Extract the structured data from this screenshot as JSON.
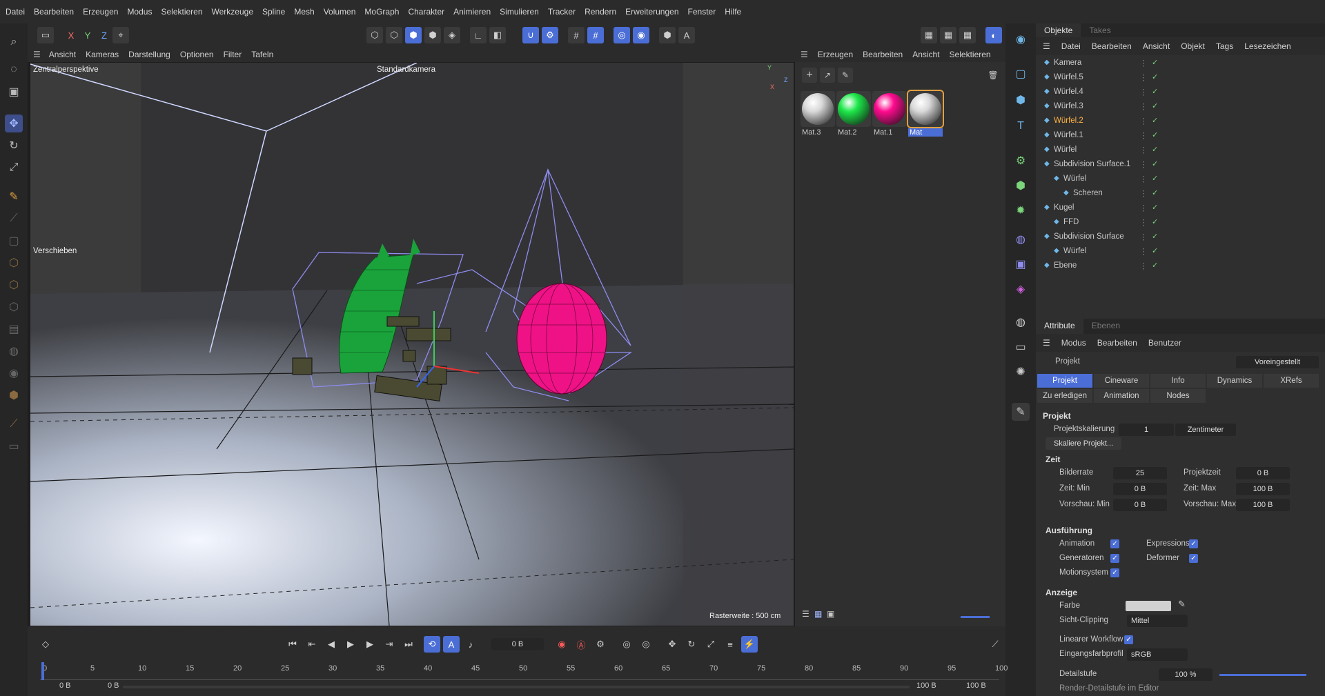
{
  "menubar": [
    "Datei",
    "Bearbeiten",
    "Erzeugen",
    "Modus",
    "Selektieren",
    "Werkzeuge",
    "Spline",
    "Mesh",
    "Volumen",
    "MoGraph",
    "Charakter",
    "Animieren",
    "Simulieren",
    "Tracker",
    "Rendern",
    "Erweiterungen",
    "Fenster",
    "Hilfe"
  ],
  "toolbar": {
    "x": "X",
    "y": "Y",
    "z": "Z"
  },
  "viewport": {
    "menu": [
      "Ansicht",
      "Kameras",
      "Darstellung",
      "Optionen",
      "Filter",
      "Tafeln"
    ],
    "perspective": "Zentralperspektive",
    "camera": "Standardkamera",
    "tool": "Verschieben",
    "grid_info": "Rasterweite : 500 cm",
    "axis_labels": {
      "y": "Y",
      "z": "Z",
      "x": "X"
    }
  },
  "material_manager": {
    "menu": [
      "Erzeugen",
      "Bearbeiten",
      "Ansicht",
      "Selektieren"
    ],
    "materials": [
      {
        "name": "Mat.3",
        "color": "#d9d9d9",
        "selected": false
      },
      {
        "name": "Mat.2",
        "color": "#1ee84a",
        "selected": false
      },
      {
        "name": "Mat.1",
        "color": "#ff0b8f",
        "selected": false
      },
      {
        "name": "Mat",
        "color": "#d9d9d9",
        "selected": true
      }
    ]
  },
  "objects_panel": {
    "tabs": [
      "Objekte",
      "Takes"
    ],
    "menu": [
      "Datei",
      "Bearbeiten",
      "Ansicht",
      "Objekt",
      "Tags",
      "Lesezeichen"
    ],
    "rows": [
      {
        "name": "Kamera",
        "indent": 0,
        "highlight": false
      },
      {
        "name": "Würfel.5",
        "indent": 0,
        "highlight": false
      },
      {
        "name": "Würfel.4",
        "indent": 0,
        "highlight": false
      },
      {
        "name": "Würfel.3",
        "indent": 0,
        "highlight": false
      },
      {
        "name": "Würfel.2",
        "indent": 0,
        "highlight": true
      },
      {
        "name": "Würfel.1",
        "indent": 0,
        "highlight": false
      },
      {
        "name": "Würfel",
        "indent": 0,
        "highlight": false
      },
      {
        "name": "Subdivision Surface.1",
        "indent": 0,
        "highlight": false
      },
      {
        "name": "Würfel",
        "indent": 1,
        "highlight": false
      },
      {
        "name": "Scheren",
        "indent": 2,
        "highlight": false
      },
      {
        "name": "Kugel",
        "indent": 0,
        "highlight": false
      },
      {
        "name": "FFD",
        "indent": 1,
        "highlight": false
      },
      {
        "name": "Subdivision Surface",
        "indent": 0,
        "highlight": false
      },
      {
        "name": "Würfel",
        "indent": 1,
        "highlight": false
      },
      {
        "name": "Ebene",
        "indent": 0,
        "highlight": false
      }
    ]
  },
  "attributes": {
    "tabs": [
      "Attribute",
      "Ebenen"
    ],
    "menu": [
      "Modus",
      "Bearbeiten",
      "Benutzer"
    ],
    "object": "Projekt",
    "preset": "Voreingestellt",
    "subtabs1": [
      "Projekt",
      "Cineware",
      "Info",
      "Dynamics",
      "XRefs"
    ],
    "subtabs2": [
      "Zu erledigen",
      "Animation",
      "Nodes"
    ],
    "section": "Projekt",
    "scale_label": "Projektskalierung",
    "scale_value": "1",
    "scale_unit": "Zentimeter",
    "scale_button": "Skaliere Projekt...",
    "zeit": {
      "title": "Zeit",
      "bildrate_label": "Bilderrate",
      "bildrate": "25",
      "projektzeit_label": "Projektzeit",
      "projektzeit": "0 B",
      "zeitmin_label": "Zeit: Min",
      "zeitmin": "0 B",
      "zeitmax_label": "Zeit: Max",
      "zeitmax": "100 B",
      "vorschaumin_label": "Vorschau: Min",
      "vorschaumin": "0 B",
      "vorschaumax_label": "Vorschau: Max",
      "vorschaumax": "100 B"
    },
    "ausfuehrung": {
      "title": "Ausführung",
      "animation": "Animation",
      "expressions": "Expressions",
      "generatoren": "Generatoren",
      "deformer": "Deformer",
      "motionsystem": "Motionsystem"
    },
    "anzeige": {
      "title": "Anzeige",
      "farbe": "Farbe",
      "sichtclipping_label": "Sicht-Clipping",
      "sichtclipping": "Mittel",
      "linear": "Linearer Workflow",
      "eingang_label": "Eingangsfarbprofil",
      "eingang": "sRGB",
      "detail_label": "Detailstufe",
      "detail": "100 %",
      "render_detail": "Render-Detailstufe im Editor"
    }
  },
  "timeline": {
    "current_frame": "0 B",
    "ticks": [
      "0",
      "5",
      "10",
      "15",
      "20",
      "25",
      "30",
      "35",
      "40",
      "45",
      "50",
      "55",
      "60",
      "65",
      "70",
      "75",
      "80",
      "85",
      "90",
      "95",
      "100"
    ],
    "range_start": "0 B",
    "range_start2": "0 B",
    "range_end": "100 B",
    "range_end2": "100 B"
  }
}
